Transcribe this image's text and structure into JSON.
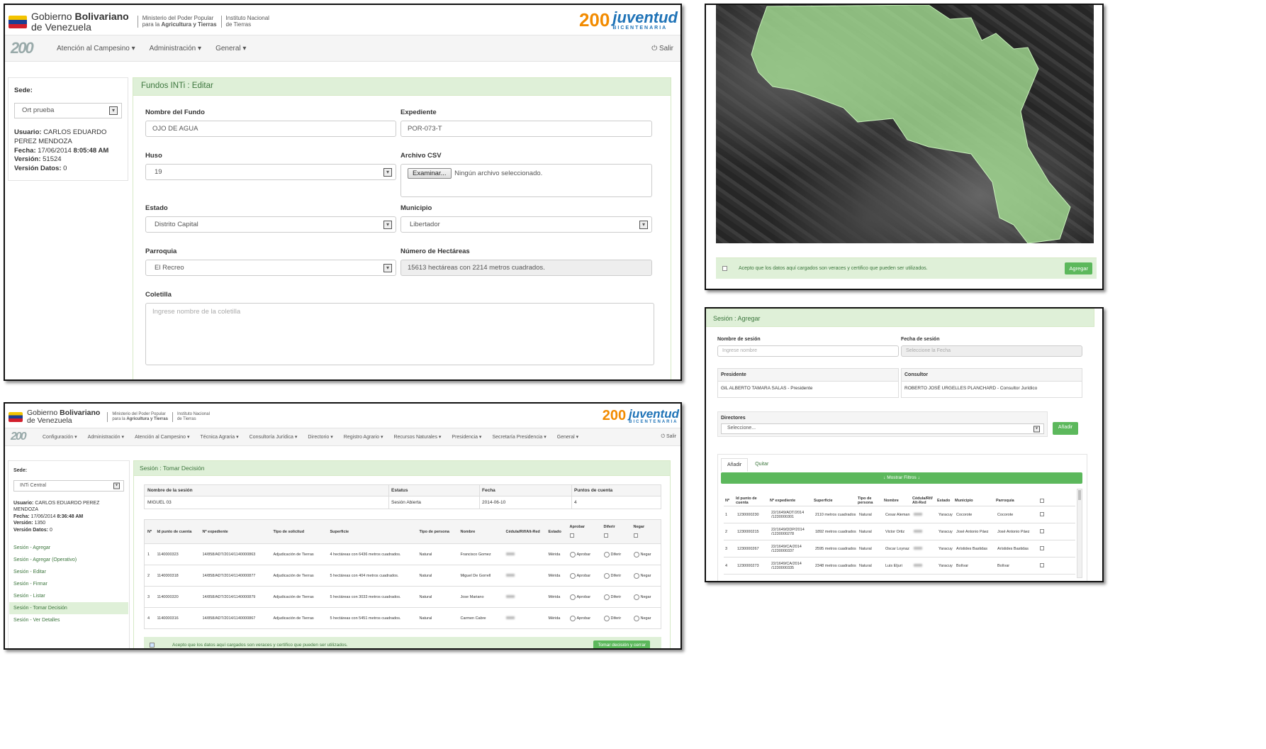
{
  "header": {
    "gov_line1": "Gobierno",
    "gov_bold": "Bolivariano",
    "gov_line2": "de Venezuela",
    "ministry_line1": "Ministerio del Poder Popular",
    "ministry_line2_pre": "para la",
    "ministry_line2_bold": "Agricultura y Tierras",
    "inst_line1": "Instituto Nacional",
    "inst_line2": "de Tierras",
    "juventud_num": "200",
    "juventud": "juventud",
    "juventud_sub": "BICENTENARIA",
    "app_logo": "200"
  },
  "panel_a": {
    "nav": [
      "Atención al Campesino",
      "Administración",
      "General"
    ],
    "logout": "Salir",
    "sidebar": {
      "sede_label": "Sede:",
      "sede_value": "Ort prueba",
      "usuario_label": "Usuario:",
      "usuario_value": "CARLOS EDUARDO PEREZ MENDOZA",
      "fecha_label": "Fecha:",
      "fecha_value": "17/06/2014",
      "fecha_time": "8:05:48 AM",
      "version_label": "Versión:",
      "version_value": "51524",
      "version_datos_label": "Versión Datos:",
      "version_datos_value": "0"
    },
    "form": {
      "heading": "Fundos INTi : Editar",
      "nombre_label": "Nombre del Fundo",
      "nombre_value": "OJO DE AGUA",
      "expediente_label": "Expediente",
      "expediente_value": "POR-073-T",
      "huso_label": "Huso",
      "huso_value": "19",
      "csv_label": "Archivo CSV",
      "csv_button": "Examinar...",
      "csv_status": "Ningún archivo seleccionado.",
      "estado_label": "Estado",
      "estado_value": "Distrito Capital",
      "municipio_label": "Municipio",
      "municipio_value": "Libertador",
      "parroquia_label": "Parroquia",
      "parroquia_value": "El Recreo",
      "hectareas_label": "Número de Hectáreas",
      "hectareas_value": "15613 hectáreas con 2214 metros cuadrados.",
      "coletilla_label": "Coletilla",
      "coletilla_placeholder": "Ingrese nombre de la coletilla"
    }
  },
  "panel_b": {
    "accept_text": "Acepto que los datos aquí cargados son veraces y certifico que pueden ser utilizados.",
    "button": "Agregar"
  },
  "panel_c": {
    "heading": "Sesión : Agregar",
    "nombre_label": "Nombre de sesión",
    "nombre_placeholder": "Ingrese nombre",
    "fecha_label": "Fecha de sesión",
    "fecha_placeholder": "Seleccione la Fecha",
    "presidente_label": "Presidente",
    "presidente_value": "GIL ALBERTO TAMARA SALAS - Presidente",
    "consultor_label": "Consultor",
    "consultor_value": "ROBERTO JOSÉ URGELLES PLANCHARD - Consultor Jurídico",
    "directores_label": "Directores",
    "directores_value": "Seleccione...",
    "add_button": "Añadir",
    "tabs": [
      "Añadir",
      "Quitar"
    ],
    "filter_button": "↓ Mostrar Filtros ↓",
    "columns": [
      "Nº",
      "Id punto de cuenta",
      "Nº expediente",
      "Superficie",
      "Tipo de persona",
      "Nombre",
      "Cédula/Rif/ Alt-Red",
      "Estado",
      "Municipio",
      "Parroquia"
    ],
    "rows": [
      [
        "1",
        "1230000230",
        "22/1649/ADT/2014 /1230000301",
        "2110 metros cuadrados",
        "Natural",
        "Cesar Aleman",
        "Yaracuy",
        "Cocorote",
        "Cocorote"
      ],
      [
        "2",
        "1230000215",
        "22/1649/DDP/2014 /1230000278",
        "1892 metros cuadrados",
        "Natural",
        "Victor Ortiz",
        "Yaracuy",
        "José Antonio Páez",
        "José Antonio Páez"
      ],
      [
        "3",
        "1230000267",
        "22/1649/CA/2014 /1230000337",
        "2595 metros cuadrados",
        "Natural",
        "Oscar Loynaz",
        "Yaracuy",
        "Arístides Bastidas",
        "Arístides Bastidas"
      ],
      [
        "4",
        "1230000273",
        "22/1649/CA/2014 /1230000335",
        "2348 metros cuadrados",
        "Natural",
        "Luis Eljuri",
        "Yaracuy",
        "Bolívar",
        "Bolívar"
      ]
    ]
  },
  "panel_d": {
    "nav": [
      "Configuración",
      "Administración",
      "Atención al Campesino",
      "Técnica Agraria",
      "Consultoría Jurídica",
      "Directorio",
      "Registro Agrario",
      "Recursos Naturales",
      "Presidencia",
      "Secretaría Presidencia",
      "General"
    ],
    "logout": "Salir",
    "sidebar": {
      "sede_label": "Sede:",
      "sede_value": "INTi Central",
      "usuario_label": "Usuario:",
      "usuario_value": "CARLOS EDUARDO PEREZ MENDOZA",
      "fecha_label": "Fecha:",
      "fecha_value": "17/06/2014",
      "fecha_time": "8:36:48 AM",
      "version_label": "Versión:",
      "version_value": "1350",
      "version_datos_label": "Versión Datos:",
      "version_datos_value": "0",
      "links": [
        "Sesión - Agregar",
        "Sesión - Agregar (Operativo)",
        "Sesión - Editar",
        "Sesión - Firmar",
        "Sesión - Listar",
        "Sesión - Tomar Decisión",
        "Sesión - Ver Detalles"
      ]
    },
    "heading": "Sesión : Tomar Decisión",
    "session_cols": [
      "Nombre de la sesión",
      "Estatus",
      "Fecha",
      "Puntos de cuenta"
    ],
    "session_row": [
      "MIGUEL 03",
      "Sesión Abierta",
      "2014-06-10",
      "4"
    ],
    "columns": [
      "Nº",
      "Id punto de cuenta",
      "Nº expediente",
      "Tipo de solicitud",
      "Superficie",
      "Tipo de persona",
      "Nombre",
      "Cédula/Rif/Alt-Red",
      "Estado",
      "Aprobar",
      "Diferir",
      "Negar"
    ],
    "options": [
      "Aprobar",
      "Diferir",
      "Negar"
    ],
    "rows": [
      [
        "1",
        "1140000323",
        "14/858/ADT/2014/1140000863",
        "Adjudicación de Tierras",
        "4 hectáreas con 6436 metros cuadrados.",
        "Natural",
        "Francisco Gomez",
        "Mérida"
      ],
      [
        "2",
        "1140000318",
        "14/858/ADT/2014/1140000877",
        "Adjudicación de Tierras",
        "5 hectáreas con 404 metros cuadrados.",
        "Natural",
        "Miguel De Gorrell",
        "Mérida"
      ],
      [
        "3",
        "1140000320",
        "14/858/ADT/2014/1140000879",
        "Adjudicación de Tierras",
        "5 hectáreas con 3033 metros cuadrados.",
        "Natural",
        "Jose Mariano",
        "Mérida"
      ],
      [
        "4",
        "1140000316",
        "14/858/ADT/2014/1140000867",
        "Adjudicación de Tierras",
        "5 hectáreas con 5451 metros cuadrados.",
        "Natural",
        "Carmen Cabre",
        "Mérida"
      ]
    ],
    "accept_text": "Acepto que los datos aquí cargados son veraces y certifico que pueden ser utilizados.",
    "button": "Tomar decisión y cerrar"
  }
}
